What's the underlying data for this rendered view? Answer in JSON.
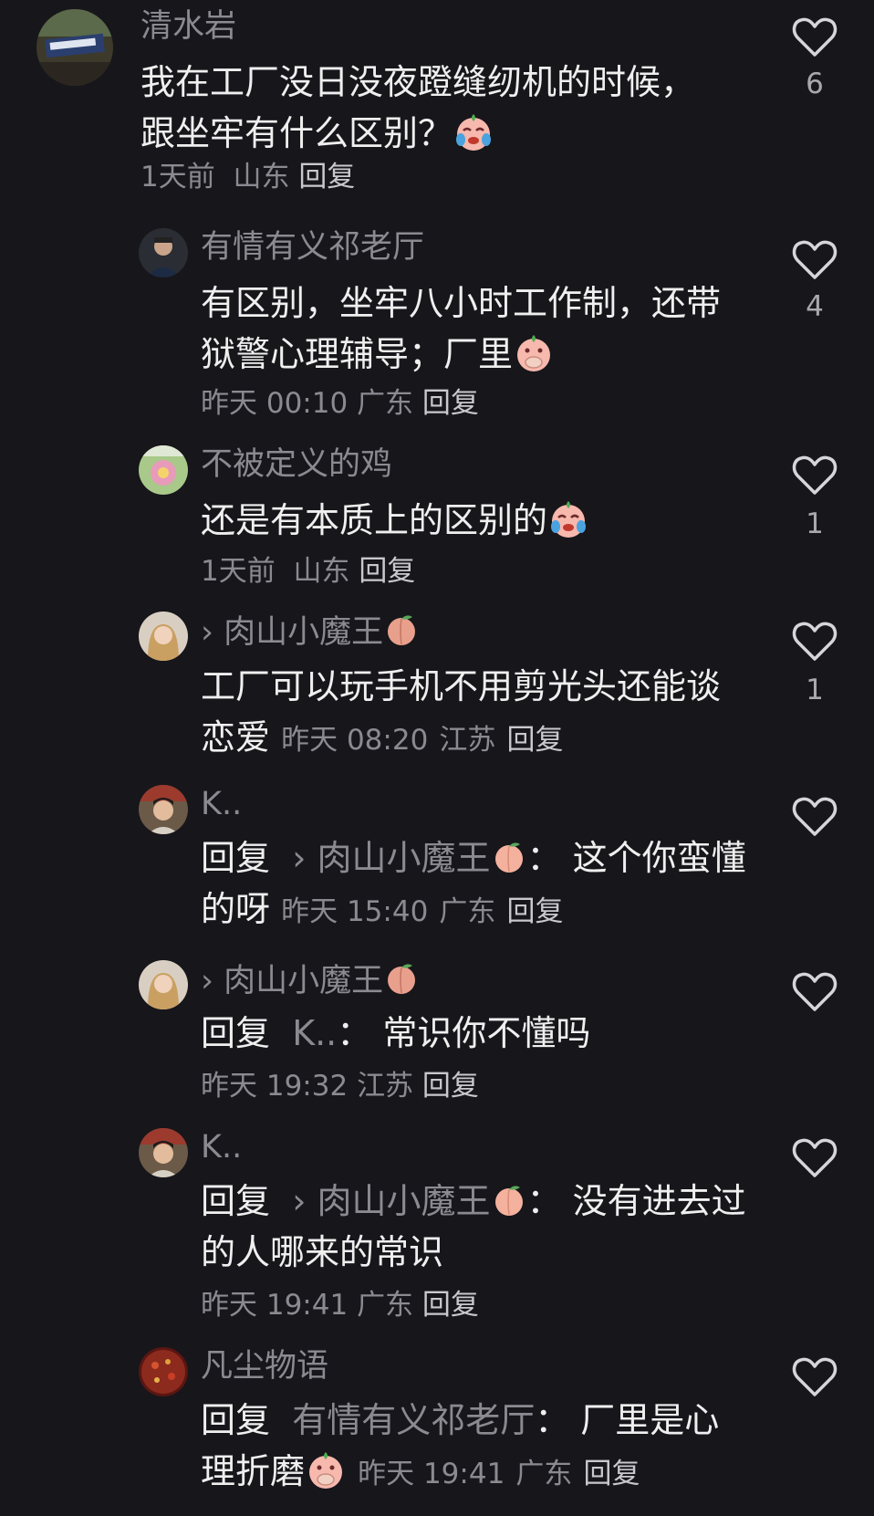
{
  "comments": [
    {
      "username": "清水岩",
      "text": "我在工厂没日没夜蹬缝纫机的时候，跟坐牢有什么区别？",
      "time": "1天前",
      "location": "山东",
      "reply_label": "回复",
      "likes": "6",
      "emoji": "crying-face-emoji"
    },
    {
      "username": "有情有义祁老厅",
      "text": "有区别，坐牢八小时工作制，还带狱警心理辅导；厂里",
      "time": "昨天 00:10",
      "location": "广东",
      "reply_label": "回复",
      "likes": "4",
      "emoji": "hand-over-mouth-emoji"
    },
    {
      "username": "不被定义的鸡",
      "text": "还是有本质上的区别的",
      "time": "1天前",
      "location": "山东",
      "reply_label": "回复",
      "likes": "1",
      "emoji": "crying-face-emoji"
    },
    {
      "username": "肉山小魔王",
      "text": "工厂可以玩手机不用剪光头还能谈恋爱",
      "time": "昨天 08:20",
      "location": "江苏",
      "reply_label": "回复",
      "likes": "1",
      "emoji": "peach-emoji"
    },
    {
      "username": "K..",
      "reply_prefix": "回复",
      "reply_to": "肉山小魔王",
      "text": "这个你蛮懂的呀",
      "time": "昨天 15:40",
      "location": "广东",
      "reply_label": "回复"
    },
    {
      "username": "肉山小魔王",
      "reply_prefix": "回复",
      "reply_to": "K..",
      "text": "常识你不懂吗",
      "time": "昨天 19:32",
      "location": "江苏",
      "reply_label": "回复"
    },
    {
      "username": "K..",
      "reply_prefix": "回复",
      "reply_to": "肉山小魔王",
      "text": "没有进去过的人哪来的常识",
      "time": "昨天 19:41",
      "location": "广东",
      "reply_label": "回复"
    },
    {
      "username": "凡尘物语",
      "reply_prefix": "回复",
      "reply_to": "有情有义祁老厅",
      "text": "厂里是心理折磨",
      "time": "昨天 19:41",
      "location": "广东",
      "reply_label": "回复"
    }
  ],
  "colors": {
    "background": "#17161b",
    "primary_text": "#efefef",
    "secondary_text": "#8b8a90"
  },
  "icons": {
    "like": "heart-outline-icon"
  }
}
